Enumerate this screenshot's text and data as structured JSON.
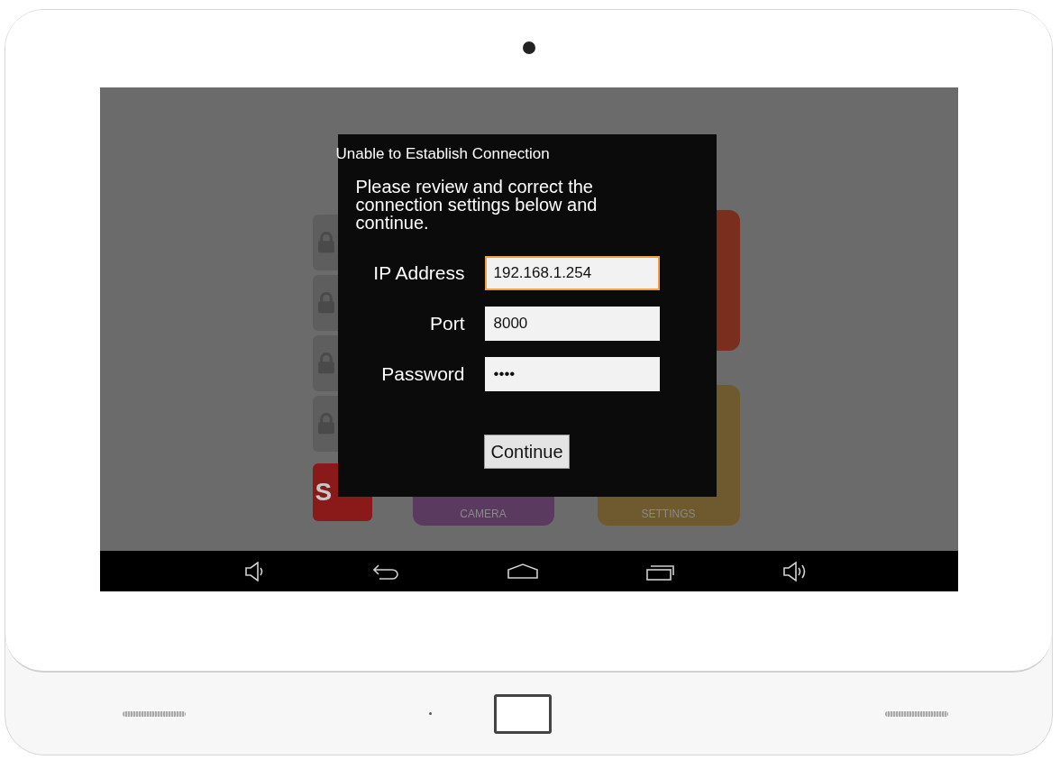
{
  "background_tiles": [
    {
      "kind": "lock"
    },
    {
      "kind": "lock"
    },
    {
      "kind": "lock"
    },
    {
      "kind": "lock"
    },
    {
      "kind": "sos",
      "label": "S"
    }
  ],
  "app_tiles": [
    {
      "label": "CAMERA",
      "color": "#5a3a5e"
    },
    {
      "color": "#7a2e1e"
    },
    {
      "label": "SETTINGS",
      "color": "#6e5a2e"
    }
  ],
  "dialog": {
    "title": "Unable to Establish Connection",
    "message": "Please review and correct the connection settings below and continue.",
    "fields": [
      {
        "label": "IP Address",
        "value": "192.168.1.254",
        "focused": true
      },
      {
        "label": "Port",
        "value": "8000",
        "focused": false
      },
      {
        "label": "Password",
        "value": "••••",
        "focused": false
      }
    ],
    "button": "Continue"
  },
  "nav_bar": [
    {
      "kind": "volume-down"
    },
    {
      "kind": "back"
    },
    {
      "kind": "home"
    },
    {
      "kind": "recents"
    },
    {
      "kind": "volume-up"
    }
  ]
}
